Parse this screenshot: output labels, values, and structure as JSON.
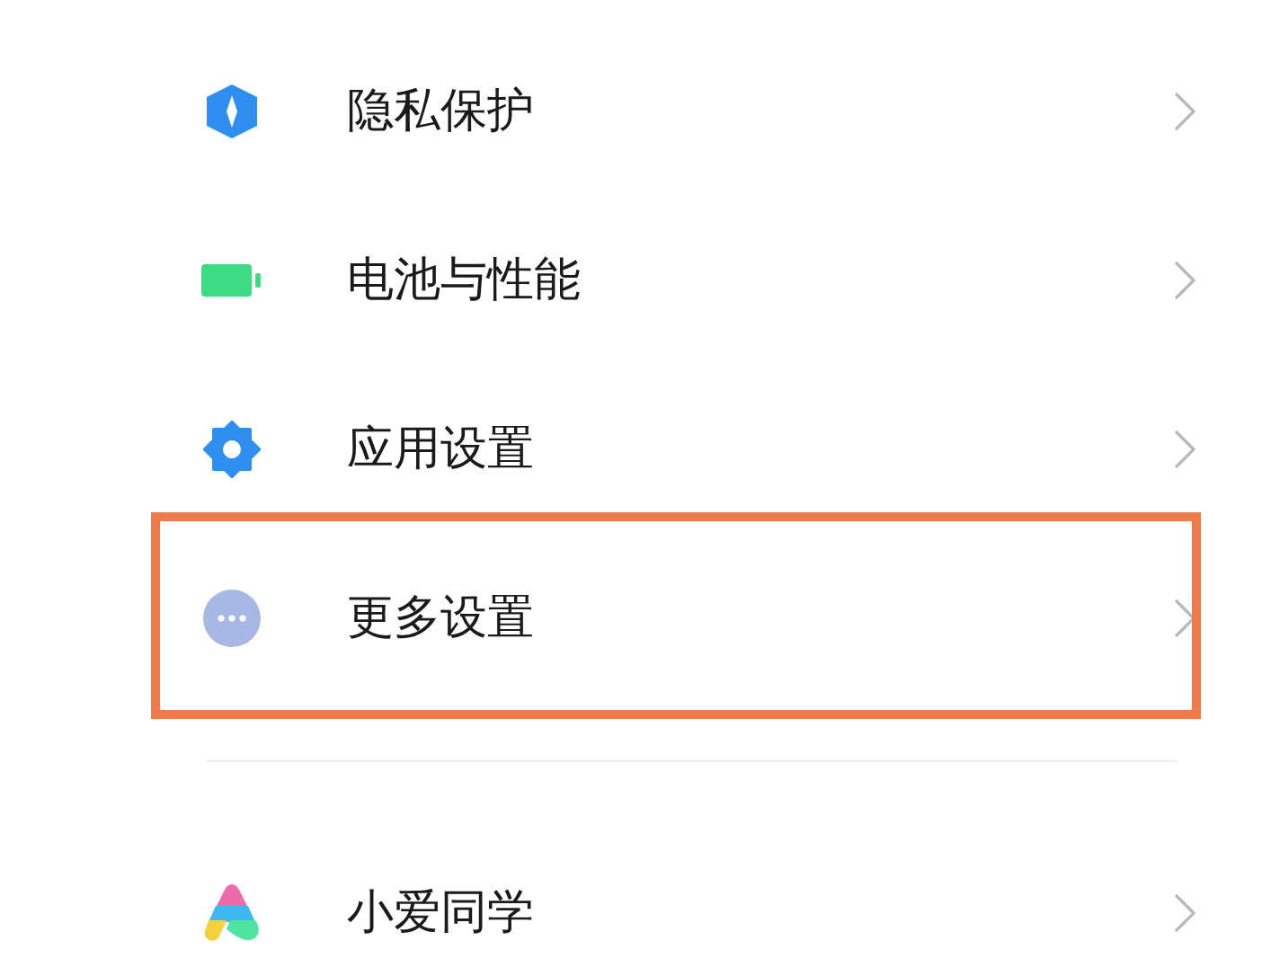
{
  "groups": [
    {
      "items": [
        {
          "kind": "shield",
          "label": "隐私保护",
          "highlighted": false
        },
        {
          "kind": "battery",
          "label": "电池与性能",
          "highlighted": false
        },
        {
          "kind": "gear",
          "label": "应用设置",
          "highlighted": false
        },
        {
          "kind": "more",
          "label": "更多设置",
          "highlighted": true
        }
      ]
    },
    {
      "items": [
        {
          "kind": "assistant",
          "label": "小爱同学",
          "highlighted": false
        }
      ]
    }
  ]
}
